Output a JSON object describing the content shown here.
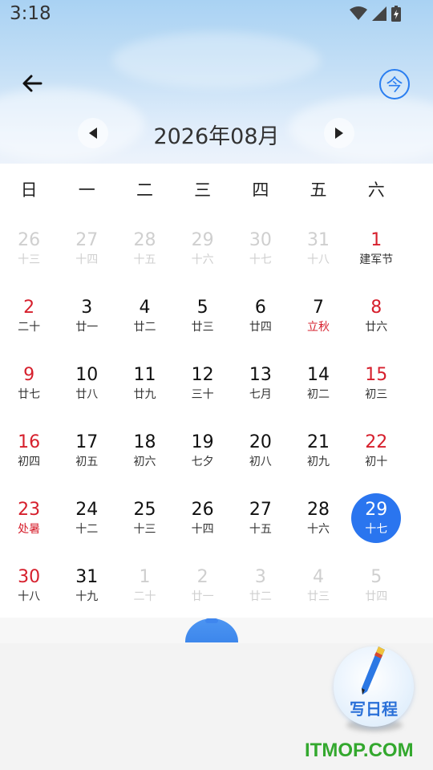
{
  "status_bar": {
    "time": "3:18"
  },
  "header": {
    "month_title": "2026年08月",
    "today_label": "今"
  },
  "weekdays": [
    "日",
    "一",
    "二",
    "三",
    "四",
    "五",
    "六"
  ],
  "weeks": [
    [
      {
        "d": "26",
        "l": "十三",
        "t": "other"
      },
      {
        "d": "27",
        "l": "十四",
        "t": "other"
      },
      {
        "d": "28",
        "l": "十五",
        "t": "other"
      },
      {
        "d": "29",
        "l": "十六",
        "t": "other"
      },
      {
        "d": "30",
        "l": "十七",
        "t": "other"
      },
      {
        "d": "31",
        "l": "十八",
        "t": "other"
      },
      {
        "d": "1",
        "l": "建军节",
        "t": "weekend"
      }
    ],
    [
      {
        "d": "2",
        "l": "二十",
        "t": "weekend"
      },
      {
        "d": "3",
        "l": "廿一",
        "t": ""
      },
      {
        "d": "4",
        "l": "廿二",
        "t": ""
      },
      {
        "d": "5",
        "l": "廿三",
        "t": ""
      },
      {
        "d": "6",
        "l": "廿四",
        "t": ""
      },
      {
        "d": "7",
        "l": "立秋",
        "t": "festival"
      },
      {
        "d": "8",
        "l": "廿六",
        "t": "weekend"
      }
    ],
    [
      {
        "d": "9",
        "l": "廿七",
        "t": "weekend"
      },
      {
        "d": "10",
        "l": "廿八",
        "t": ""
      },
      {
        "d": "11",
        "l": "廿九",
        "t": ""
      },
      {
        "d": "12",
        "l": "三十",
        "t": ""
      },
      {
        "d": "13",
        "l": "七月",
        "t": ""
      },
      {
        "d": "14",
        "l": "初二",
        "t": ""
      },
      {
        "d": "15",
        "l": "初三",
        "t": "weekend"
      }
    ],
    [
      {
        "d": "16",
        "l": "初四",
        "t": "weekend"
      },
      {
        "d": "17",
        "l": "初五",
        "t": ""
      },
      {
        "d": "18",
        "l": "初六",
        "t": ""
      },
      {
        "d": "19",
        "l": "七夕",
        "t": ""
      },
      {
        "d": "20",
        "l": "初八",
        "t": ""
      },
      {
        "d": "21",
        "l": "初九",
        "t": ""
      },
      {
        "d": "22",
        "l": "初十",
        "t": "weekend"
      }
    ],
    [
      {
        "d": "23",
        "l": "处暑",
        "t": "weekend festival"
      },
      {
        "d": "24",
        "l": "十二",
        "t": ""
      },
      {
        "d": "25",
        "l": "十三",
        "t": ""
      },
      {
        "d": "26",
        "l": "十四",
        "t": ""
      },
      {
        "d": "27",
        "l": "十五",
        "t": ""
      },
      {
        "d": "28",
        "l": "十六",
        "t": ""
      },
      {
        "d": "29",
        "l": "十七",
        "t": "selected"
      }
    ],
    [
      {
        "d": "30",
        "l": "十八",
        "t": "weekend"
      },
      {
        "d": "31",
        "l": "十九",
        "t": ""
      },
      {
        "d": "1",
        "l": "二十",
        "t": "other"
      },
      {
        "d": "2",
        "l": "廿一",
        "t": "other"
      },
      {
        "d": "3",
        "l": "廿二",
        "t": "other"
      },
      {
        "d": "4",
        "l": "廿三",
        "t": "other"
      },
      {
        "d": "5",
        "l": "廿四",
        "t": "other"
      }
    ]
  ],
  "write_button": {
    "label": "写日程"
  },
  "watermark": "ITMOP.COM",
  "colors": {
    "accent": "#2a75ef",
    "holiday": "#d61f2c",
    "watermark": "#33a82e"
  },
  "icons": [
    "wifi-icon",
    "signal-icon",
    "battery-icon",
    "back-arrow-icon",
    "prev-month-icon",
    "next-month-icon",
    "pen-icon"
  ]
}
